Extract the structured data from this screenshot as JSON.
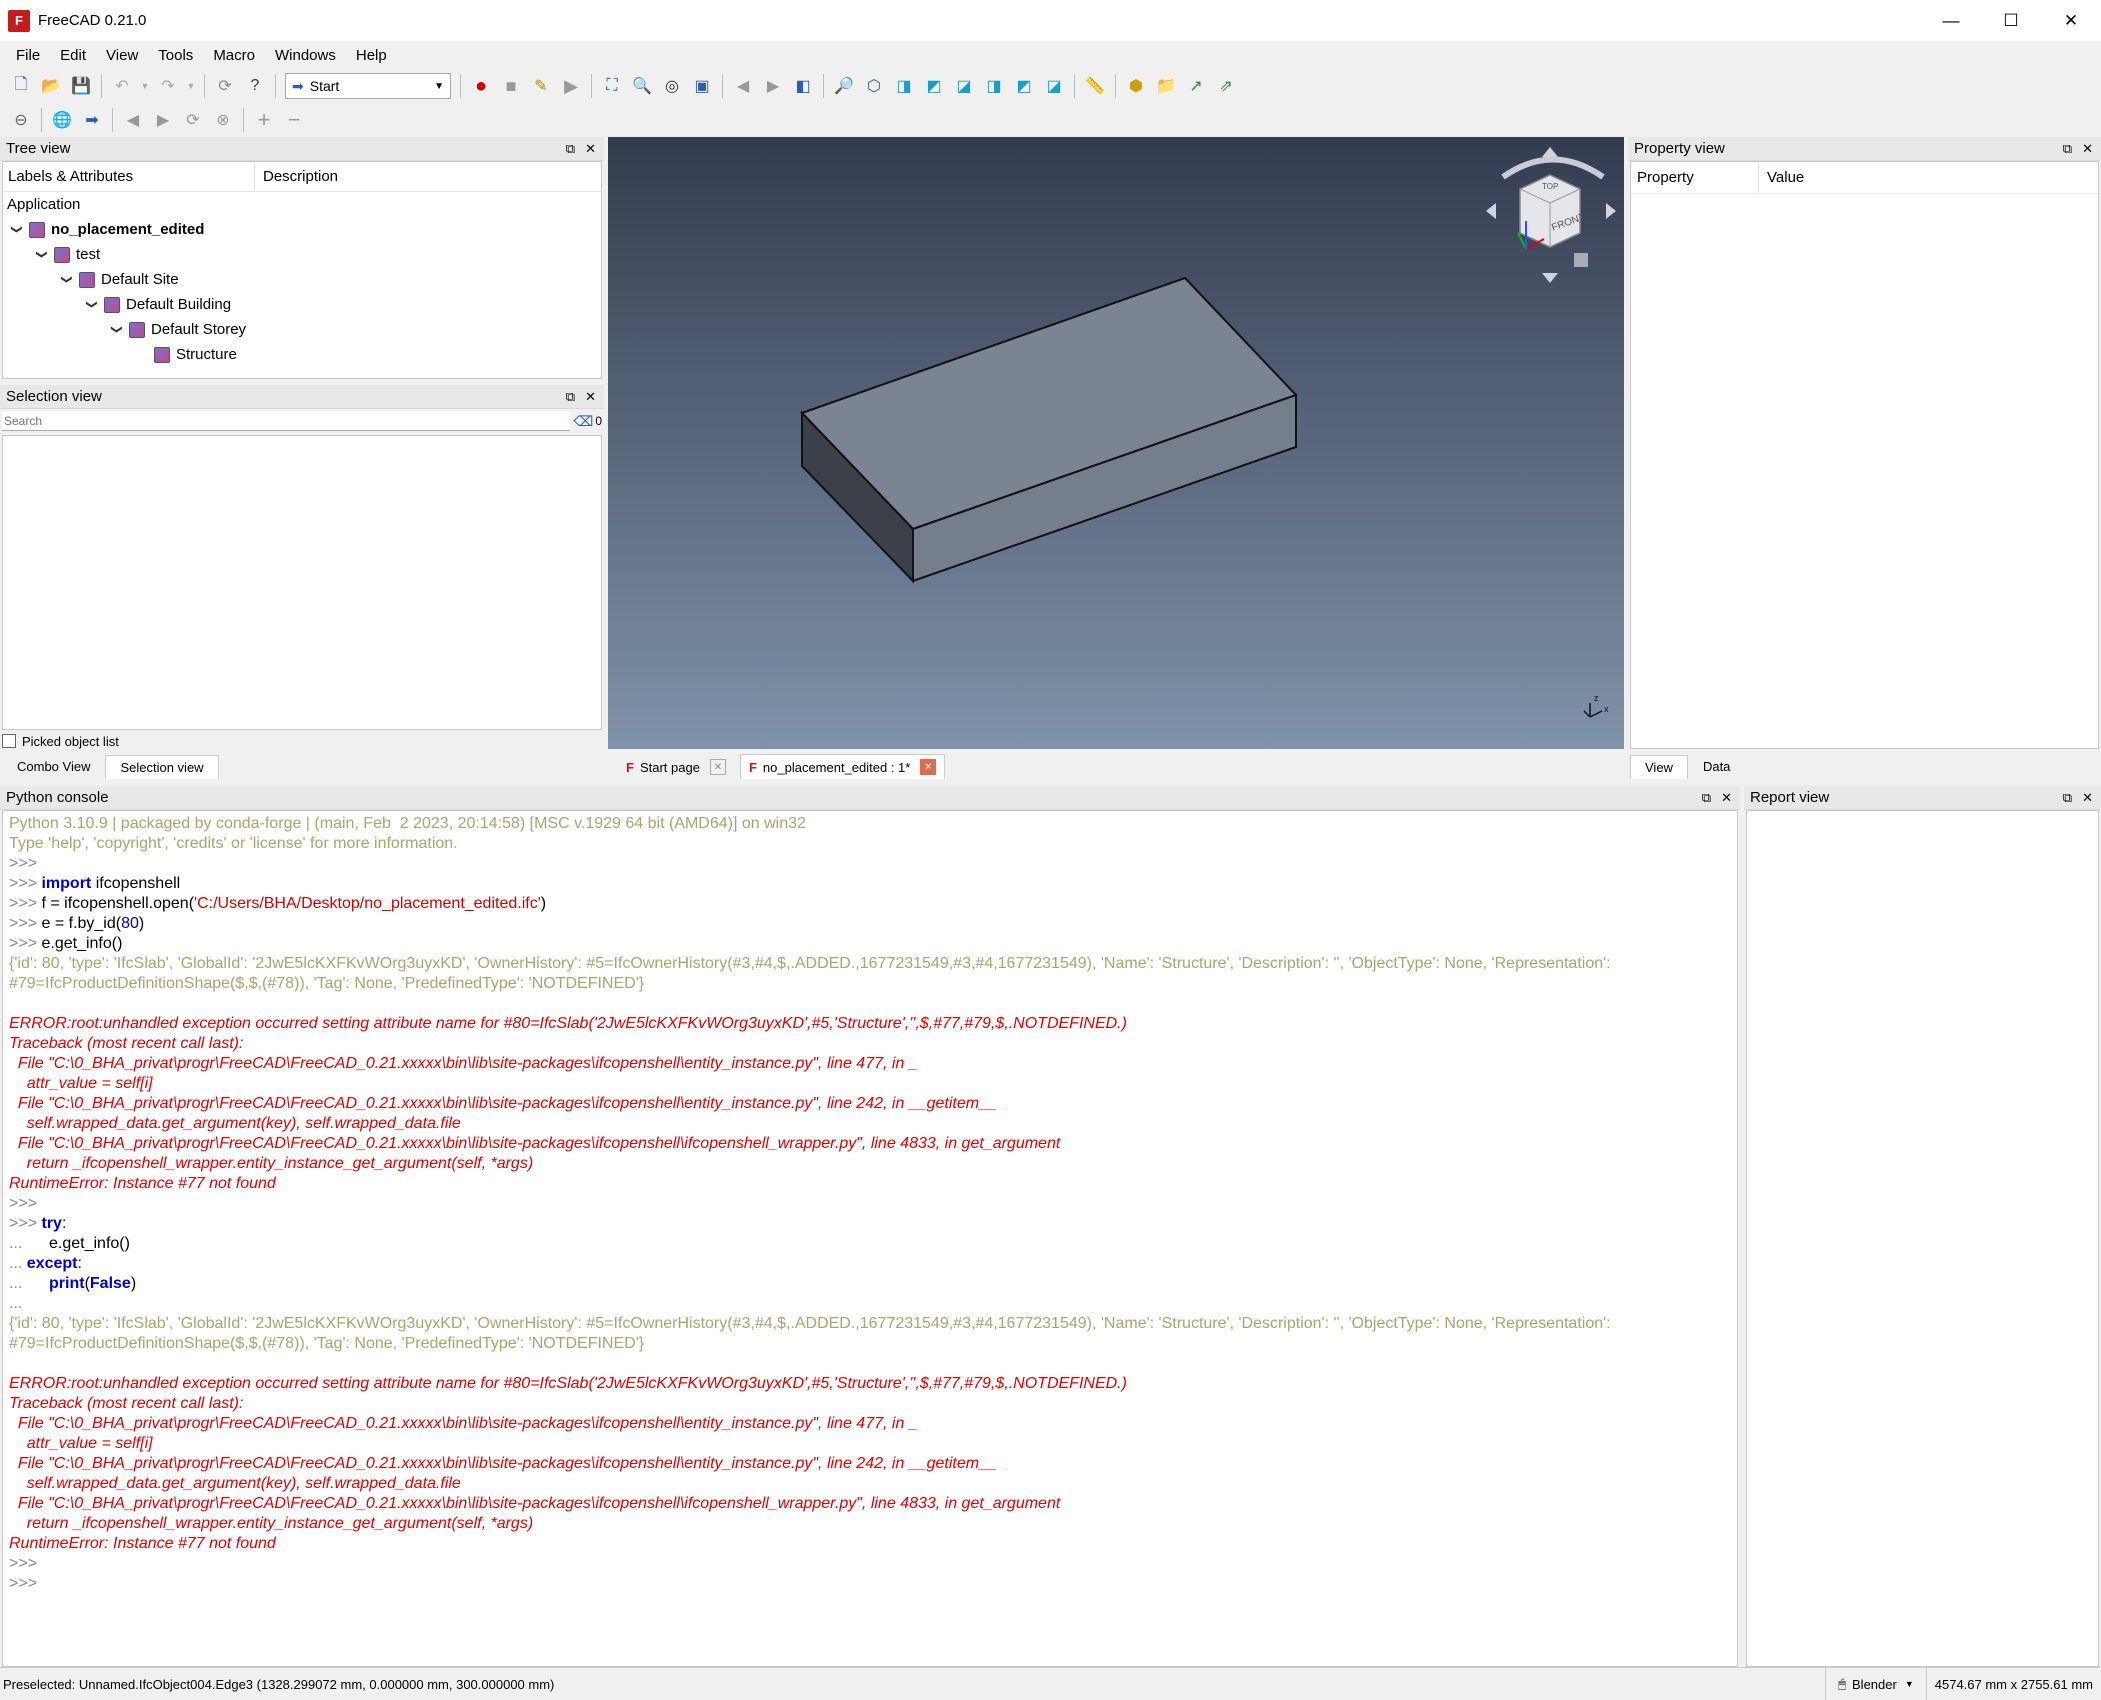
{
  "window": {
    "title": "FreeCAD 0.21.0",
    "minimize": "—",
    "maximize": "☐",
    "close": "✕"
  },
  "menu": [
    "File",
    "Edit",
    "View",
    "Tools",
    "Macro",
    "Windows",
    "Help"
  ],
  "toolbar": {
    "workbench": "Start"
  },
  "tree_view": {
    "title": "Tree view",
    "col_labels": "Labels & Attributes",
    "col_description": "Description",
    "section": "Application",
    "items": [
      {
        "label": "no_placement_edited",
        "level": 0,
        "bold": true,
        "expanded": true
      },
      {
        "label": "test",
        "level": 1,
        "expanded": true
      },
      {
        "label": "Default Site",
        "level": 2,
        "expanded": true
      },
      {
        "label": "Default Building",
        "level": 3,
        "expanded": true
      },
      {
        "label": "Default Storey",
        "level": 4,
        "expanded": true
      },
      {
        "label": "Structure",
        "level": 5,
        "expanded": false
      }
    ]
  },
  "selection_view": {
    "title": "Selection view",
    "search_placeholder": "Search",
    "count": "0",
    "picked_label": "Picked object list"
  },
  "combo_tabs": [
    "Combo View",
    "Selection view"
  ],
  "viewport_tabs": [
    {
      "label": "Start page"
    },
    {
      "label": "no_placement_edited : 1*"
    }
  ],
  "navcube": {
    "top": "TOP",
    "front": "FRONT"
  },
  "property_view": {
    "title": "Property view",
    "col_property": "Property",
    "col_value": "Value",
    "tabs": [
      "View",
      "Data"
    ]
  },
  "python_console": {
    "title": "Python console",
    "lines": [
      {
        "type": "gray",
        "text": "Python 3.10.9 | packaged by conda-forge | (main, Feb  2 2023, 20:14:58) [MSC v.1929 64 bit (AMD64)] on win32"
      },
      {
        "type": "gray",
        "text": "Type 'help', 'copyright', 'credits' or 'license' for more information."
      },
      {
        "type": "prompt",
        "text": ">>> "
      },
      {
        "type": "code",
        "prompt": ">>> ",
        "kw": "import",
        "rest": " ifcopenshell"
      },
      {
        "type": "code2",
        "prompt": ">>> ",
        "pre": "f = ifcopenshell.open(",
        "str": "'C:/Users/BHA/Desktop/no_placement_edited.ifc'",
        "post": ")"
      },
      {
        "type": "code3",
        "prompt": ">>> ",
        "pre": "e = f.by_id(",
        "num": "80",
        "post": ")"
      },
      {
        "type": "plain",
        "prompt": ">>> ",
        "text": "e.get_info()"
      },
      {
        "type": "gray",
        "text": "{'id': 80, 'type': 'IfcSlab', 'GlobalId': '2JwE5lcKXFKvWOrg3uyxKD', 'OwnerHistory': #5=IfcOwnerHistory(#3,#4,$,.ADDED.,1677231549,#3,#4,1677231549), 'Name': 'Structure', 'Description': '', 'ObjectType': None, 'Representation': #79=IfcProductDefinitionShape($,$,(#78)), 'Tag': None, 'PredefinedType': 'NOTDEFINED'}"
      },
      {
        "type": "blank",
        "text": " "
      },
      {
        "type": "err",
        "text": "ERROR:root:unhandled exception occurred setting attribute name for #80=IfcSlab('2JwE5lcKXFKvWOrg3uyxKD',#5,'Structure','',$,#77,#79,$,.NOTDEFINED.)"
      },
      {
        "type": "err",
        "text": "Traceback (most recent call last):"
      },
      {
        "type": "err",
        "text": "  File \"C:\\0_BHA_privat\\progr\\FreeCAD\\FreeCAD_0.21.xxxxx\\bin\\lib\\site-packages\\ifcopenshell\\entity_instance.py\", line 477, in _"
      },
      {
        "type": "err",
        "text": "    attr_value = self[i]"
      },
      {
        "type": "err",
        "text": "  File \"C:\\0_BHA_privat\\progr\\FreeCAD\\FreeCAD_0.21.xxxxx\\bin\\lib\\site-packages\\ifcopenshell\\entity_instance.py\", line 242, in __getitem__"
      },
      {
        "type": "err",
        "text": "    self.wrapped_data.get_argument(key), self.wrapped_data.file"
      },
      {
        "type": "err",
        "text": "  File \"C:\\0_BHA_privat\\progr\\FreeCAD\\FreeCAD_0.21.xxxxx\\bin\\lib\\site-packages\\ifcopenshell\\ifcopenshell_wrapper.py\", line 4833, in get_argument"
      },
      {
        "type": "err",
        "text": "    return _ifcopenshell_wrapper.entity_instance_get_argument(self, *args)"
      },
      {
        "type": "err",
        "text": "RuntimeError: Instance #77 not found"
      },
      {
        "type": "prompt",
        "text": ">>> "
      },
      {
        "type": "kwline",
        "prompt": ">>> ",
        "kw": "try",
        "rest": ":"
      },
      {
        "type": "plain",
        "prompt": "...      ",
        "text": "e.get_info()"
      },
      {
        "type": "kwline",
        "prompt": "... ",
        "kw": "except",
        "rest": ":"
      },
      {
        "type": "kwline2",
        "prompt": "...      ",
        "kw": "print",
        "mid": "(",
        "kw2": "False",
        "rest": ")"
      },
      {
        "type": "prompt",
        "text": "..."
      },
      {
        "type": "gray",
        "text": "{'id': 80, 'type': 'IfcSlab', 'GlobalId': '2JwE5lcKXFKvWOrg3uyxKD', 'OwnerHistory': #5=IfcOwnerHistory(#3,#4,$,.ADDED.,1677231549,#3,#4,1677231549), 'Name': 'Structure', 'Description': '', 'ObjectType': None, 'Representation': #79=IfcProductDefinitionShape($,$,(#78)), 'Tag': None, 'PredefinedType': 'NOTDEFINED'}"
      },
      {
        "type": "blank",
        "text": " "
      },
      {
        "type": "err",
        "text": "ERROR:root:unhandled exception occurred setting attribute name for #80=IfcSlab('2JwE5lcKXFKvWOrg3uyxKD',#5,'Structure','',$,#77,#79,$,.NOTDEFINED.)"
      },
      {
        "type": "err",
        "text": "Traceback (most recent call last):"
      },
      {
        "type": "err",
        "text": "  File \"C:\\0_BHA_privat\\progr\\FreeCAD\\FreeCAD_0.21.xxxxx\\bin\\lib\\site-packages\\ifcopenshell\\entity_instance.py\", line 477, in _"
      },
      {
        "type": "err",
        "text": "    attr_value = self[i]"
      },
      {
        "type": "err",
        "text": "  File \"C:\\0_BHA_privat\\progr\\FreeCAD\\FreeCAD_0.21.xxxxx\\bin\\lib\\site-packages\\ifcopenshell\\entity_instance.py\", line 242, in __getitem__"
      },
      {
        "type": "err",
        "text": "    self.wrapped_data.get_argument(key), self.wrapped_data.file"
      },
      {
        "type": "err",
        "text": "  File \"C:\\0_BHA_privat\\progr\\FreeCAD\\FreeCAD_0.21.xxxxx\\bin\\lib\\site-packages\\ifcopenshell\\ifcopenshell_wrapper.py\", line 4833, in get_argument"
      },
      {
        "type": "err",
        "text": "    return _ifcopenshell_wrapper.entity_instance_get_argument(self, *args)"
      },
      {
        "type": "err",
        "text": "RuntimeError: Instance #77 not found"
      },
      {
        "type": "prompt",
        "text": ">>> "
      },
      {
        "type": "prompt",
        "text": ">>> "
      }
    ]
  },
  "report_view": {
    "title": "Report view"
  },
  "statusbar": {
    "preselected": "Preselected: Unnamed.IfcObject004.Edge3 (1328.299072 mm, 0.000000 mm, 300.000000 mm)",
    "nav_style": "Blender",
    "dimensions": "4574.67 mm x 2755.61 mm"
  }
}
